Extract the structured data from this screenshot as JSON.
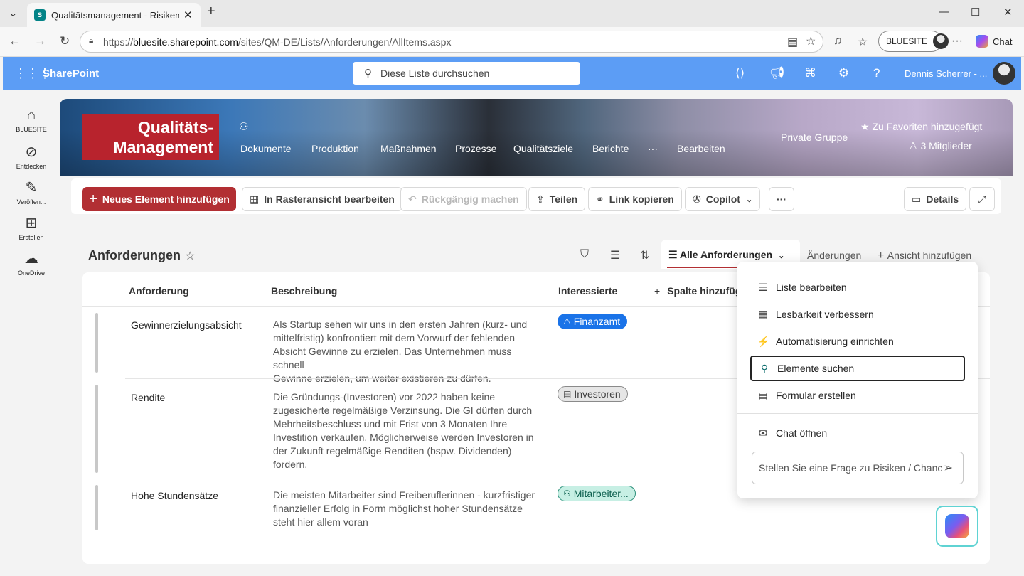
{
  "browser": {
    "tab_title": "Qualitätsmanagement - Risiken / C",
    "url_prefix": "https://",
    "url_host": "bluesite.sharepoint.com",
    "url_path": "/sites/QM-DE/Lists/Anforderungen/AllItems.aspx",
    "profile_label": "BLUESITE",
    "chat_label": "Chat"
  },
  "suite": {
    "app_name": "SharePoint",
    "search_placeholder": "Diese Liste durchsuchen",
    "user_name": "Dennis Scherrer - ..."
  },
  "rail": {
    "items": [
      {
        "label": "BLUESITE",
        "icon": "home-icon"
      },
      {
        "label": "Entdecken",
        "icon": "compass-icon"
      },
      {
        "label": "Veröffen...",
        "icon": "pen-icon"
      },
      {
        "label": "Erstellen",
        "icon": "create-icon"
      },
      {
        "label": "OneDrive",
        "icon": "cloud-icon"
      }
    ]
  },
  "header": {
    "logo_line1": "Qualitäts-",
    "logo_line2": "Management",
    "nav": [
      "Dokumente",
      "Produktion",
      "Maßnahmen",
      "Prozesse",
      "Qualitätsziele",
      "Berichte",
      "···",
      "Bearbeiten"
    ],
    "group_type": "Private Gruppe",
    "favorite": "Zu Favoriten hinzugefügt",
    "members": "3 Mitglieder"
  },
  "commandbar": {
    "new_item": "Neues Element hinzufügen",
    "grid_edit": "In Rasteransicht bearbeiten",
    "undo": "Rückgängig machen",
    "share": "Teilen",
    "copy_link": "Link kopieren",
    "copilot": "Copilot",
    "more": "···",
    "details": "Details"
  },
  "list": {
    "title": "Anforderungen",
    "view_name": "Alle Anforderungen",
    "view_changes": "Änderungen",
    "add_view": "Ansicht hinzufügen",
    "columns": [
      "Anforderung",
      "Beschreibung",
      "Interessierte",
      "Spalte hinzufüg"
    ],
    "rows": [
      {
        "anforderung": "Gewinnerzielungsabsicht",
        "beschreibung": [
          "Als Startup sehen wir uns in den ersten Jahren (kurz- und",
          "mittelfristig) konfrontiert mit dem Vorwurf der fehlenden",
          "Absicht Gewinne zu erzielen. Das Unternehmen muss schnell",
          "Gewinne erzielen, um weiter existieren zu dürfen."
        ],
        "interessierte": "Finanzamt"
      },
      {
        "anforderung": "Rendite",
        "beschreibung": [
          "Die Gründungs-(Investoren) vor 2022 haben keine",
          "zugesicherte regelmäßige Verzinsung. Die GI dürfen durch",
          "Mehrheitsbeschluss und mit Frist von 3 Monaten Ihre",
          "Investition verkaufen. Möglicherweise werden Investoren in",
          "der Zukunft regelmäßige Renditen (bspw. Dividenden)",
          "fordern."
        ],
        "interessierte": "Investoren"
      },
      {
        "anforderung": "Hohe Stundensätze",
        "beschreibung": [
          "Die meisten Mitarbeiter sind Freiberuflerinnen - kurzfristiger",
          "finanzieller Erfolg in Form möglichst hoher Stundensätze",
          "steht hier allem voran"
        ],
        "interessierte": "Mitarbeiter..."
      }
    ]
  },
  "menu": {
    "items": [
      "Liste bearbeiten",
      "Lesbarkeit verbessern",
      "Automatisierung einrichten",
      "Elemente suchen",
      "Formular erstellen"
    ],
    "chat": "Chat öffnen",
    "ask_placeholder": "Stellen Sie eine Frage zu Risiken / Chanc"
  }
}
